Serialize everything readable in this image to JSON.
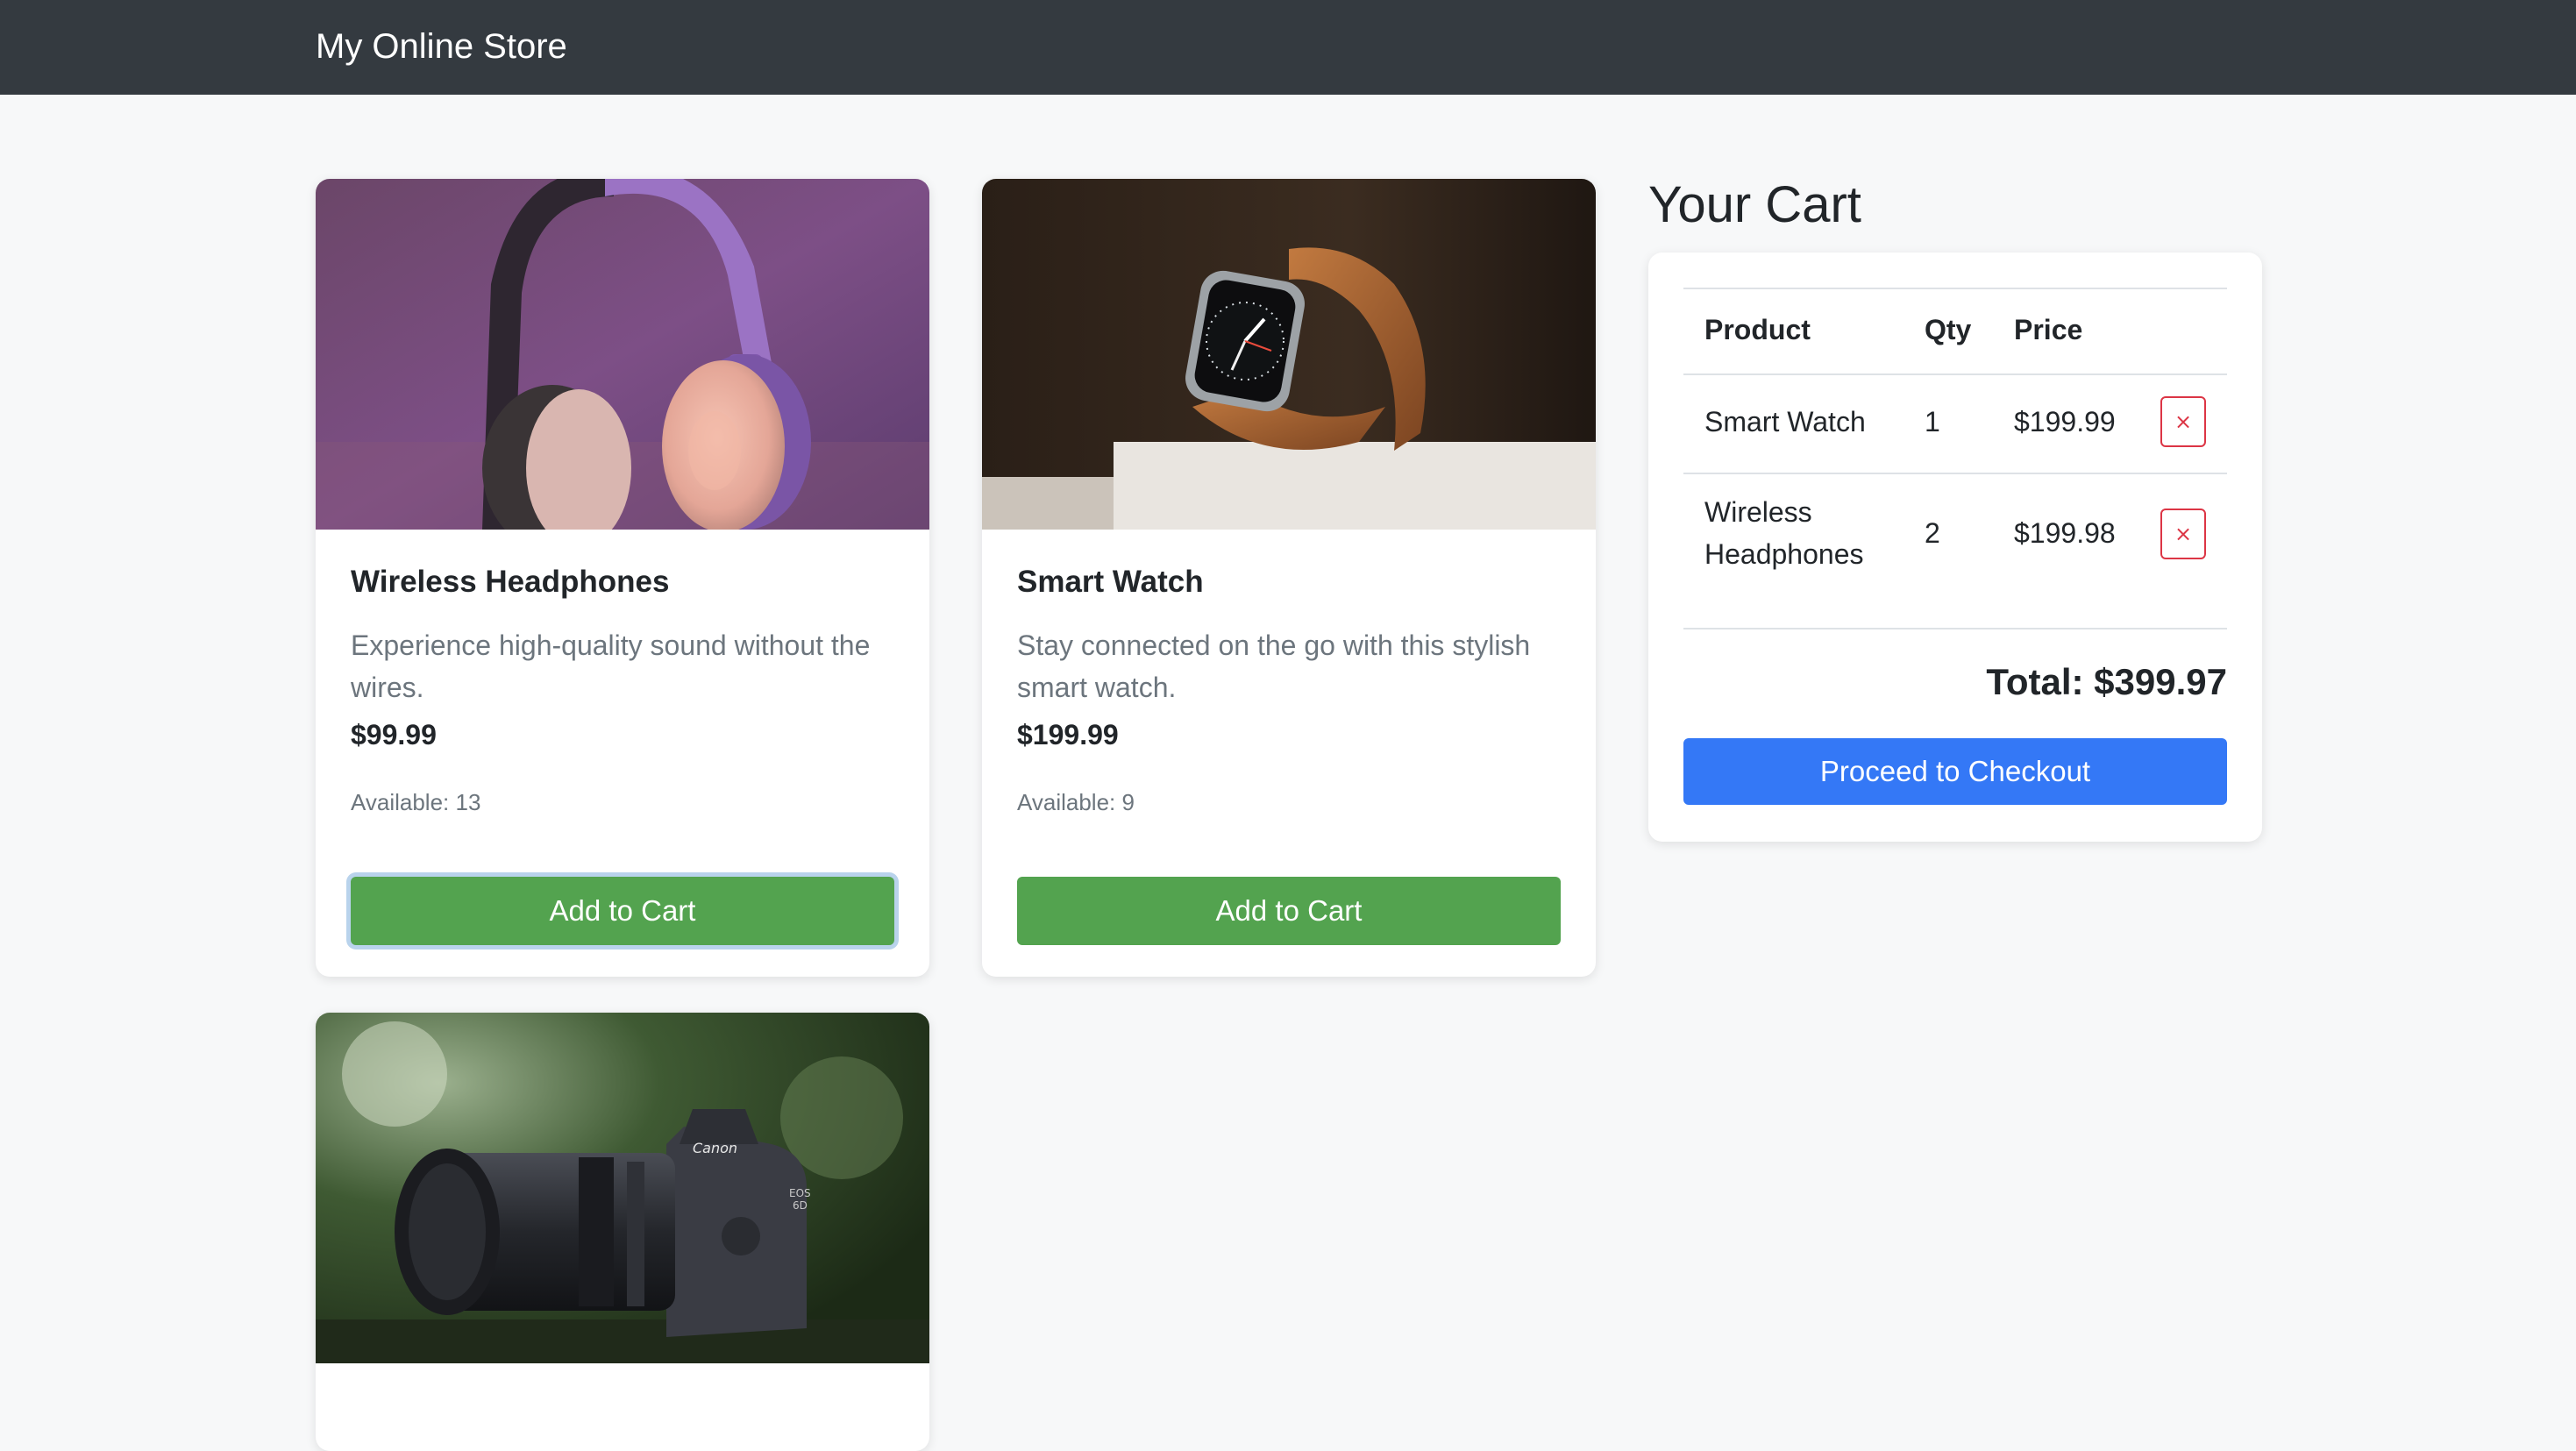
{
  "navbar": {
    "brand": "My Online Store"
  },
  "products": [
    {
      "name": "Wireless Headphones",
      "description": "Experience high-quality sound without the wires.",
      "price": "$99.99",
      "available": "Available: 13",
      "button": "Add to Cart",
      "image": "headphones-photo"
    },
    {
      "name": "Smart Watch",
      "description": "Stay connected on the go with this stylish smart watch.",
      "price": "$199.99",
      "available": "Available: 9",
      "button": "Add to Cart",
      "image": "smart-watch-photo"
    },
    {
      "image": "camera-photo",
      "image_text": [
        "Canon",
        "EOS",
        "6D"
      ]
    }
  ],
  "cart": {
    "heading": "Your Cart",
    "columns": {
      "product": "Product",
      "qty": "Qty",
      "price": "Price"
    },
    "rows": [
      {
        "product": "Smart Watch",
        "qty": "1",
        "price": "$199.99",
        "remove": "×"
      },
      {
        "product": "Wireless Headphones",
        "qty": "2",
        "price": "$199.98",
        "remove": "×"
      }
    ],
    "total": "Total: $399.97",
    "checkout": "Proceed to Checkout"
  },
  "colors": {
    "navbar": "#343a40",
    "add_button": "#53a34f",
    "checkout_button": "#3478f6",
    "remove_button": "#dc3545"
  }
}
